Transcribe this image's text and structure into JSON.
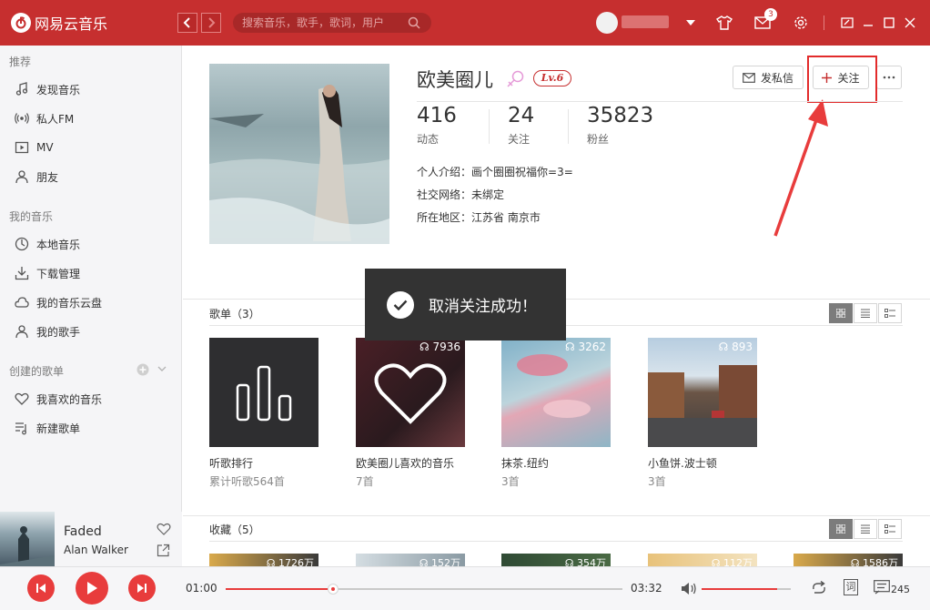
{
  "app": {
    "title": "网易云音乐",
    "brand_color": "#c62f2f"
  },
  "search": {
    "placeholder": "搜索音乐，歌手，歌词，用户"
  },
  "topbar": {
    "mail_badge": "3"
  },
  "sidebar": {
    "sections": [
      {
        "title": "推荐",
        "items": [
          {
            "label": "发现音乐",
            "icon": "music-note-icon"
          },
          {
            "label": "私人FM",
            "icon": "radio-icon"
          },
          {
            "label": "MV",
            "icon": "video-icon"
          },
          {
            "label": "朋友",
            "icon": "friends-icon"
          }
        ]
      },
      {
        "title": "我的音乐",
        "items": [
          {
            "label": "本地音乐",
            "icon": "local-music-icon"
          },
          {
            "label": "下载管理",
            "icon": "download-icon"
          },
          {
            "label": "我的音乐云盘",
            "icon": "cloud-icon"
          },
          {
            "label": "我的歌手",
            "icon": "singer-icon"
          }
        ]
      },
      {
        "title": "创建的歌单",
        "items": [
          {
            "label": "我喜欢的音乐",
            "icon": "heart-icon"
          },
          {
            "label": "新建歌单",
            "icon": "playlist-icon"
          }
        ]
      }
    ]
  },
  "now_playing": {
    "title": "Faded",
    "artist": "Alan Walker"
  },
  "profile": {
    "name": "欧美圈儿",
    "level": "Lv.6",
    "message_button": "发私信",
    "follow_button": "关注",
    "stats": [
      {
        "value": "416",
        "label": "动态"
      },
      {
        "value": "24",
        "label": "关注"
      },
      {
        "value": "35823",
        "label": "粉丝"
      }
    ],
    "info": [
      {
        "key": "个人介绍：",
        "value": "画个圈圈祝福你=3="
      },
      {
        "key": "社交网络：",
        "value": "未绑定"
      },
      {
        "key": "所在地区：",
        "value": "江苏省 南京市"
      }
    ]
  },
  "toast": {
    "message": "取消关注成功！"
  },
  "playlists": {
    "header": "歌单（3）",
    "items": [
      {
        "title": "听歌排行",
        "subtitle": "累计听歌564首",
        "count": ""
      },
      {
        "title": "欧美圈儿喜欢的音乐",
        "subtitle": "7首",
        "count": "7936"
      },
      {
        "title": "抹茶.纽约",
        "subtitle": "3首",
        "count": "3262"
      },
      {
        "title": "小鱼饼.波士顿",
        "subtitle": "3首",
        "count": "893"
      }
    ]
  },
  "collections": {
    "header": "收藏（5）",
    "counts": [
      "1726万",
      "152万",
      "354万",
      "112万",
      "1586万"
    ]
  },
  "player": {
    "current_time": "01:00",
    "total_time": "03:32",
    "progress": 0.27,
    "volume": 0.85,
    "playlist_count": "245",
    "lyrics_label": "词"
  }
}
